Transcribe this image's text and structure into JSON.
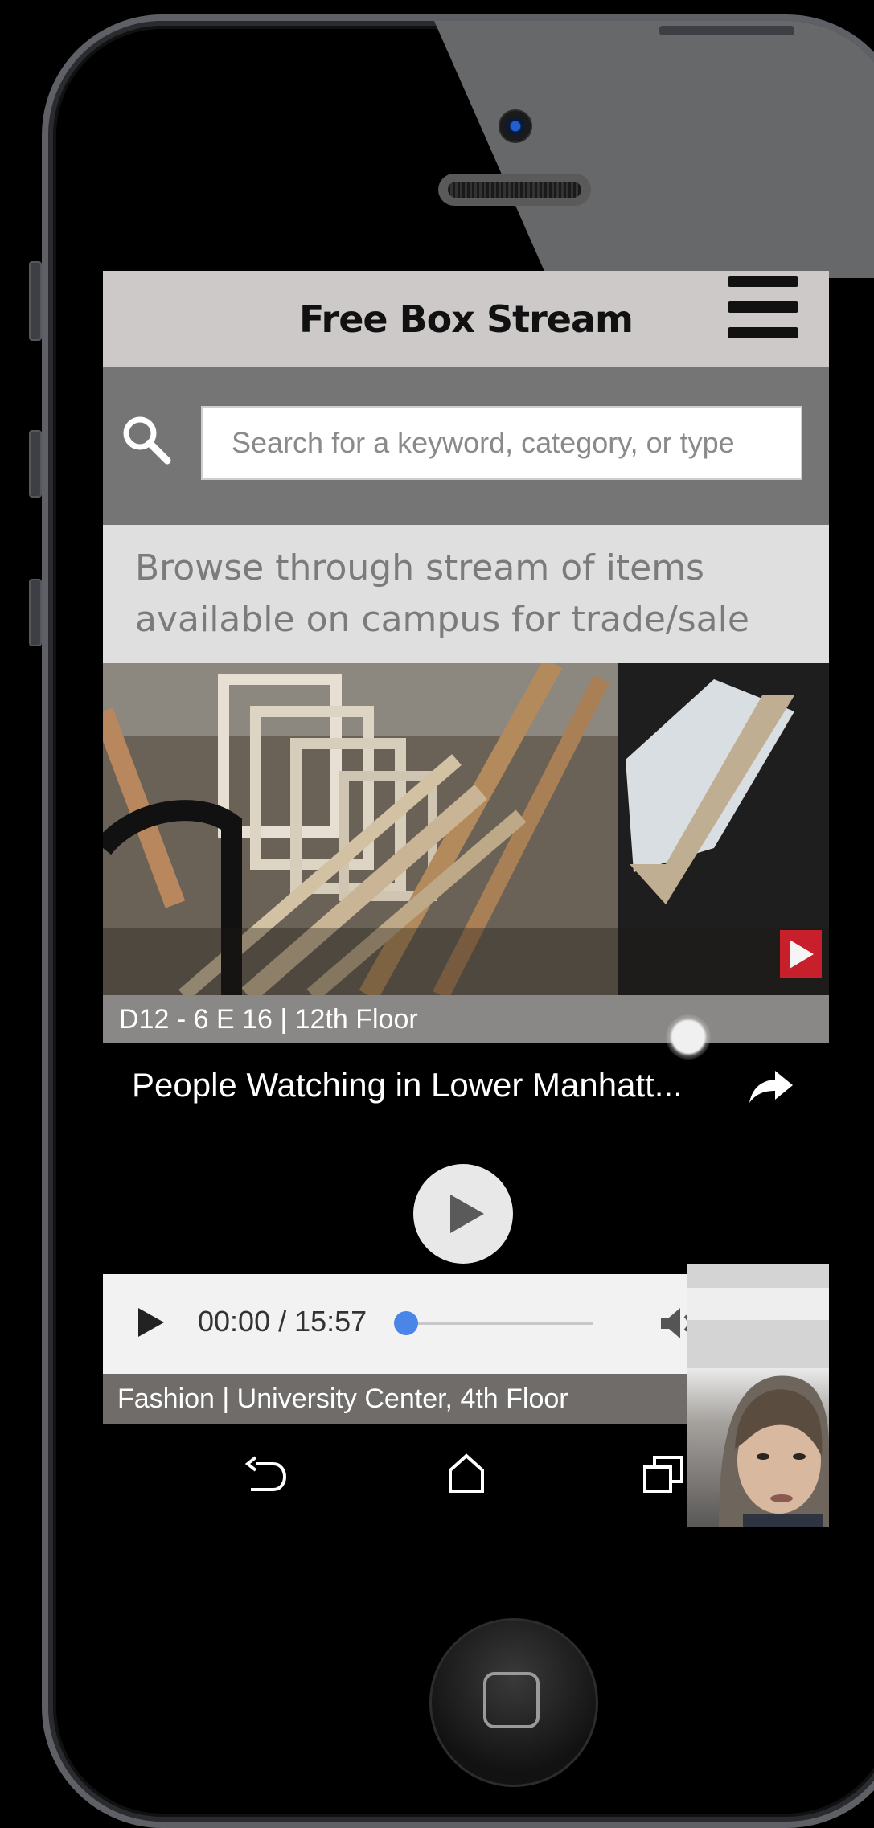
{
  "header": {
    "title": "Free Box Stream"
  },
  "search": {
    "placeholder": "Search for a keyword, category, or type"
  },
  "browse": {
    "text": "Browse through stream of items available on campus for trade/sale"
  },
  "items": [
    {
      "caption": "D12 - 6 E 16 | 12th Floor"
    },
    {
      "caption": "Fashion | University Center, 4th Floor"
    }
  ],
  "video": {
    "title": "People Watching in Lower Manhatt...",
    "current_time": "00:00",
    "separator": " / ",
    "duration": "15:57",
    "progress": 0.0
  },
  "colors": {
    "header_bg": "#cdc9c9",
    "search_band_bg": "#757575",
    "browse_bg": "#e0dfdf",
    "progress_accent": "#4a86e8",
    "badge_red": "#c8202b"
  },
  "icons": {
    "menu": "hamburger-menu-icon",
    "search": "search-icon",
    "share": "share-arrow-icon",
    "play": "play-icon",
    "volume": "volume-icon",
    "fullscreen": "fullscreen-icon",
    "nav_back": "back-icon",
    "nav_home": "home-icon",
    "nav_recents": "recents-icon"
  }
}
